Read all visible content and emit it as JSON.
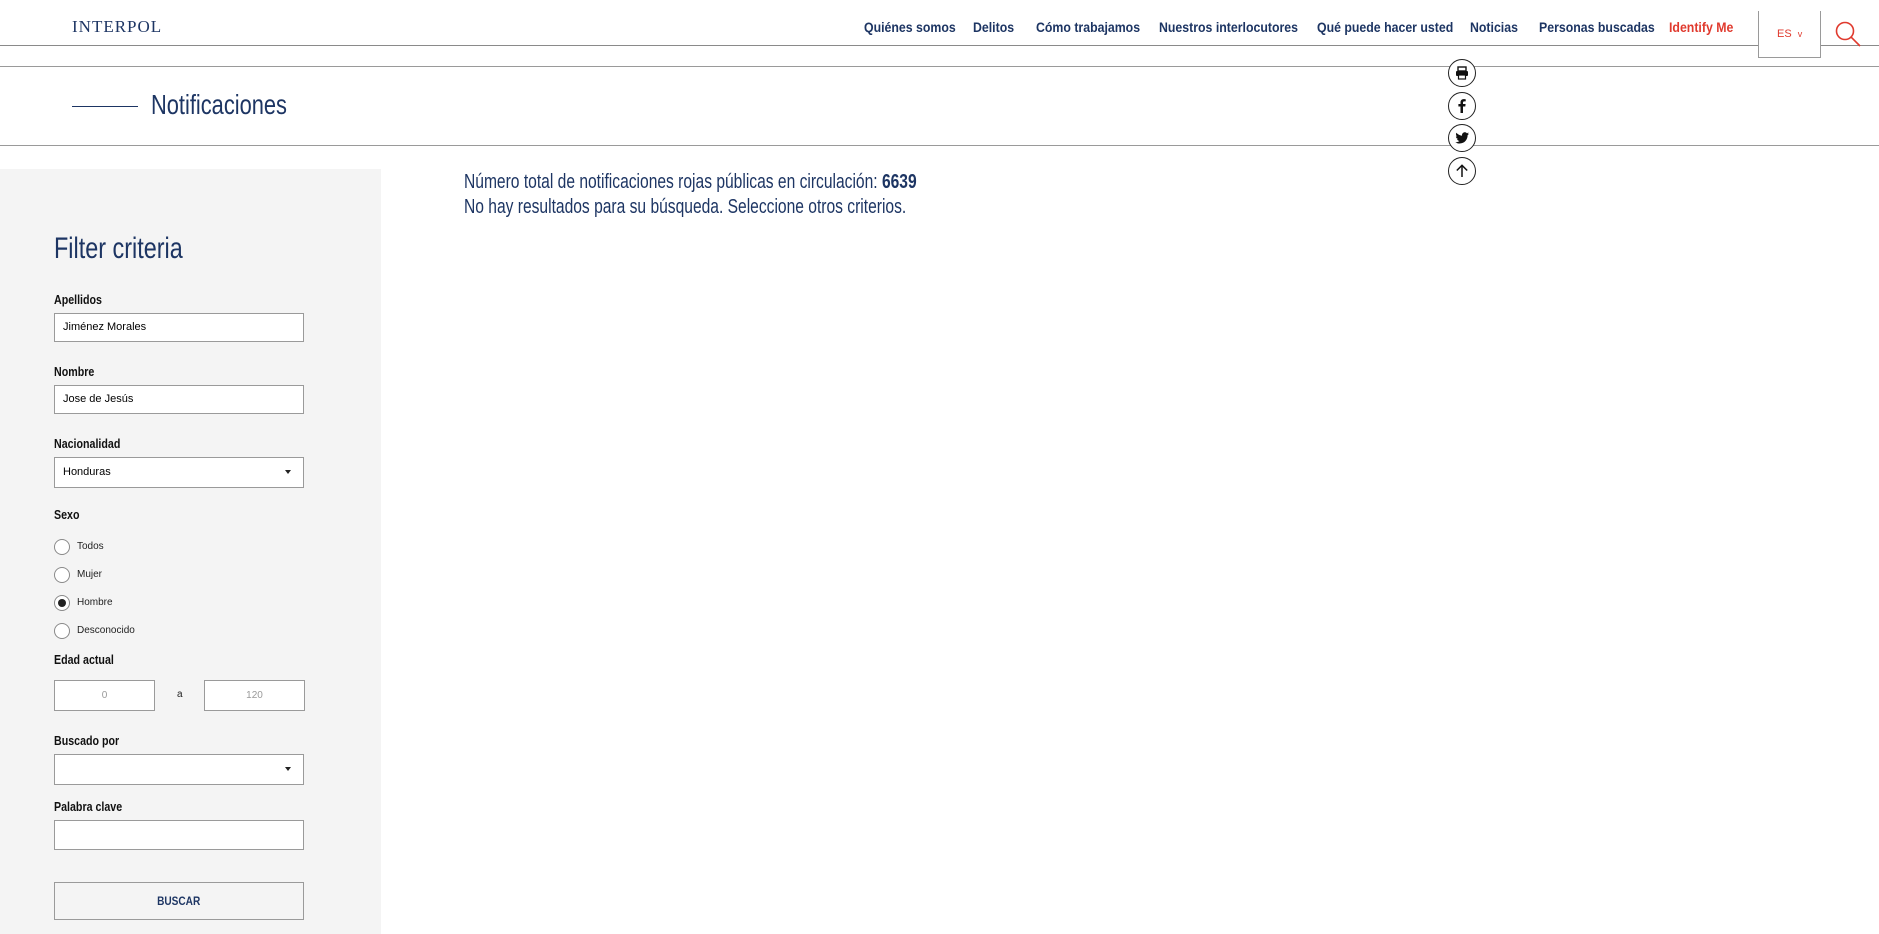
{
  "header": {
    "logo": "INTERPOL",
    "nav": [
      {
        "label": "Quiénes somos"
      },
      {
        "label": "Delitos"
      },
      {
        "label": "Cómo trabajamos"
      },
      {
        "label": "Nuestros interlocutores"
      },
      {
        "label": "Qué puede hacer usted"
      },
      {
        "label": "Noticias"
      },
      {
        "label": "Personas buscadas"
      },
      {
        "label": "Identify Me",
        "color": "#e03a2e"
      }
    ],
    "language": "ES",
    "language_caret": "v"
  },
  "page": {
    "title": "Notificaciones"
  },
  "share": [
    "print-icon",
    "facebook-icon",
    "twitter-icon",
    "arrow-up-icon"
  ],
  "filters": {
    "title": "Filter criteria",
    "surname": {
      "label": "Apellidos",
      "value": "Jiménez Morales"
    },
    "forename": {
      "label": "Nombre",
      "value": "Jose de Jesús"
    },
    "nationality": {
      "label": "Nacionalidad",
      "value": "Honduras"
    },
    "sex": {
      "label": "Sexo",
      "options": [
        "Todos",
        "Mujer",
        "Hombre",
        "Desconocido"
      ],
      "selected": "Hombre"
    },
    "age": {
      "label": "Edad actual",
      "from": "0",
      "separator": "a",
      "to": "120"
    },
    "wanted_by": {
      "label": "Buscado por",
      "value": ""
    },
    "keyword": {
      "label": "Palabra clave",
      "value": ""
    },
    "submit": "BUSCAR"
  },
  "results": {
    "total_label": "Número total de notificaciones rojas públicas en circulación: ",
    "total_value": "6639",
    "no_results": "No hay resultados para su búsqueda. Seleccione otros criterios."
  },
  "colors": {
    "brand": "#1d3563",
    "accent": "#e03a2e",
    "sidebar_bg": "#f4f4f4"
  }
}
